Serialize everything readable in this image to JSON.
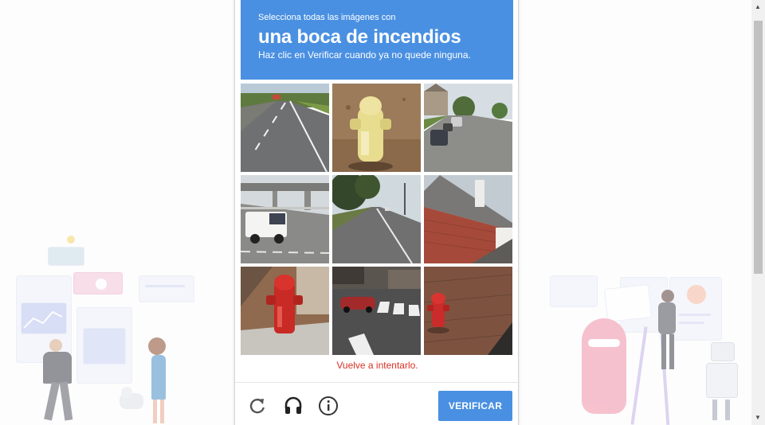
{
  "challenge": {
    "instruction_small": "Selecciona todas las imágenes con",
    "target_object": "una boca de incendios",
    "instruction_sub": "Haz clic en Verificar cuando ya no quede ninguna."
  },
  "tiles": [
    {
      "description": "highway road"
    },
    {
      "description": "yellow fire hydrant"
    },
    {
      "description": "street with parked cars"
    },
    {
      "description": "white pickup truck on highway"
    },
    {
      "description": "road with trees"
    },
    {
      "description": "brick house with chimney"
    },
    {
      "description": "red fire hydrant on sidewalk"
    },
    {
      "description": "crosswalk with red car"
    },
    {
      "description": "red fire hydrant on brick"
    }
  ],
  "error_message": "Vuelve a intentarlo.",
  "footer": {
    "reload_icon": "reload-icon",
    "audio_icon": "headphones-icon",
    "info_icon": "info-icon",
    "verify_label": "VERIFICAR"
  },
  "colors": {
    "accent": "#4a90e2",
    "error": "#d93025"
  }
}
